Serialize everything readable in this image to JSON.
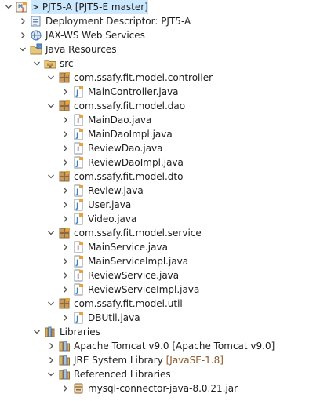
{
  "tree": [
    {
      "id": "project",
      "label": "> PJT5-A [PJT5-E master]",
      "depth": 0,
      "expanded": true,
      "icon": "java-project-icon",
      "selected": true
    },
    {
      "id": "deployment-descriptor",
      "label": "Deployment Descriptor: PJT5-A",
      "depth": 1,
      "expanded": false,
      "icon": "deployment-descriptor-icon"
    },
    {
      "id": "jax-ws",
      "label": "JAX-WS Web Services",
      "depth": 1,
      "expanded": false,
      "icon": "web-services-icon"
    },
    {
      "id": "java-resources",
      "label": "Java Resources",
      "depth": 1,
      "expanded": true,
      "icon": "java-resources-icon"
    },
    {
      "id": "src",
      "label": "src",
      "depth": 2,
      "expanded": true,
      "icon": "source-folder-icon"
    },
    {
      "id": "pkg-controller",
      "label": "com.ssafy.fit.model.controller",
      "depth": 3,
      "expanded": true,
      "icon": "package-icon"
    },
    {
      "id": "file-maincontroller",
      "label": "MainController.java",
      "depth": 4,
      "expanded": false,
      "icon": "java-class-icon"
    },
    {
      "id": "pkg-dao",
      "label": "com.ssafy.fit.model.dao",
      "depth": 3,
      "expanded": true,
      "icon": "package-icon"
    },
    {
      "id": "file-maindao",
      "label": "MainDao.java",
      "depth": 4,
      "expanded": false,
      "icon": "java-interface-icon"
    },
    {
      "id": "file-maindaoimpl",
      "label": "MainDaoImpl.java",
      "depth": 4,
      "expanded": false,
      "icon": "java-class-icon"
    },
    {
      "id": "file-reviewdao",
      "label": "ReviewDao.java",
      "depth": 4,
      "expanded": false,
      "icon": "java-interface-icon"
    },
    {
      "id": "file-reviewdaoimpl",
      "label": "ReviewDaoImpl.java",
      "depth": 4,
      "expanded": false,
      "icon": "java-class-icon"
    },
    {
      "id": "pkg-dto",
      "label": "com.ssafy.fit.model.dto",
      "depth": 3,
      "expanded": true,
      "icon": "package-icon"
    },
    {
      "id": "file-review",
      "label": "Review.java",
      "depth": 4,
      "expanded": false,
      "icon": "java-class-icon"
    },
    {
      "id": "file-user",
      "label": "User.java",
      "depth": 4,
      "expanded": false,
      "icon": "java-class-icon"
    },
    {
      "id": "file-video",
      "label": "Video.java",
      "depth": 4,
      "expanded": false,
      "icon": "java-class-icon"
    },
    {
      "id": "pkg-service",
      "label": "com.ssafy.fit.model.service",
      "depth": 3,
      "expanded": true,
      "icon": "package-icon"
    },
    {
      "id": "file-mainservice",
      "label": "MainService.java",
      "depth": 4,
      "expanded": false,
      "icon": "java-interface-icon"
    },
    {
      "id": "file-mainserviceimpl",
      "label": "MainServiceImpl.java",
      "depth": 4,
      "expanded": false,
      "icon": "java-class-icon"
    },
    {
      "id": "file-reviewservice",
      "label": "ReviewService.java",
      "depth": 4,
      "expanded": false,
      "icon": "java-interface-icon"
    },
    {
      "id": "file-reviewserviceimpl",
      "label": "ReviewServiceImpl.java",
      "depth": 4,
      "expanded": false,
      "icon": "java-class-icon"
    },
    {
      "id": "pkg-util",
      "label": "com.ssafy.fit.model.util",
      "depth": 3,
      "expanded": true,
      "icon": "package-icon"
    },
    {
      "id": "file-dbutil",
      "label": "DBUtil.java",
      "depth": 4,
      "expanded": false,
      "icon": "java-class-icon"
    },
    {
      "id": "libraries",
      "label": "Libraries",
      "depth": 2,
      "expanded": true,
      "icon": "libraries-icon"
    },
    {
      "id": "lib-tomcat",
      "label": "Apache Tomcat v9.0 [Apache Tomcat v9.0]",
      "depth": 3,
      "expanded": false,
      "icon": "library-icon"
    },
    {
      "id": "lib-jre",
      "label": "JRE System Library",
      "extra": "[JavaSE-1.8]",
      "depth": 3,
      "expanded": false,
      "icon": "library-icon"
    },
    {
      "id": "lib-referenced",
      "label": "Referenced Libraries",
      "depth": 3,
      "expanded": true,
      "icon": "library-icon"
    },
    {
      "id": "jar-mysql",
      "label": "mysql-connector-java-8.0.21.jar",
      "depth": 4,
      "expanded": false,
      "icon": "jar-icon"
    }
  ],
  "colors": {
    "selection": "#cce8ff",
    "package": "#b5894f",
    "javaClass": "#3f7fbf",
    "interface": "#7a5fa8",
    "decorationOrange": "#e6a23c",
    "chevron": "#555555"
  }
}
